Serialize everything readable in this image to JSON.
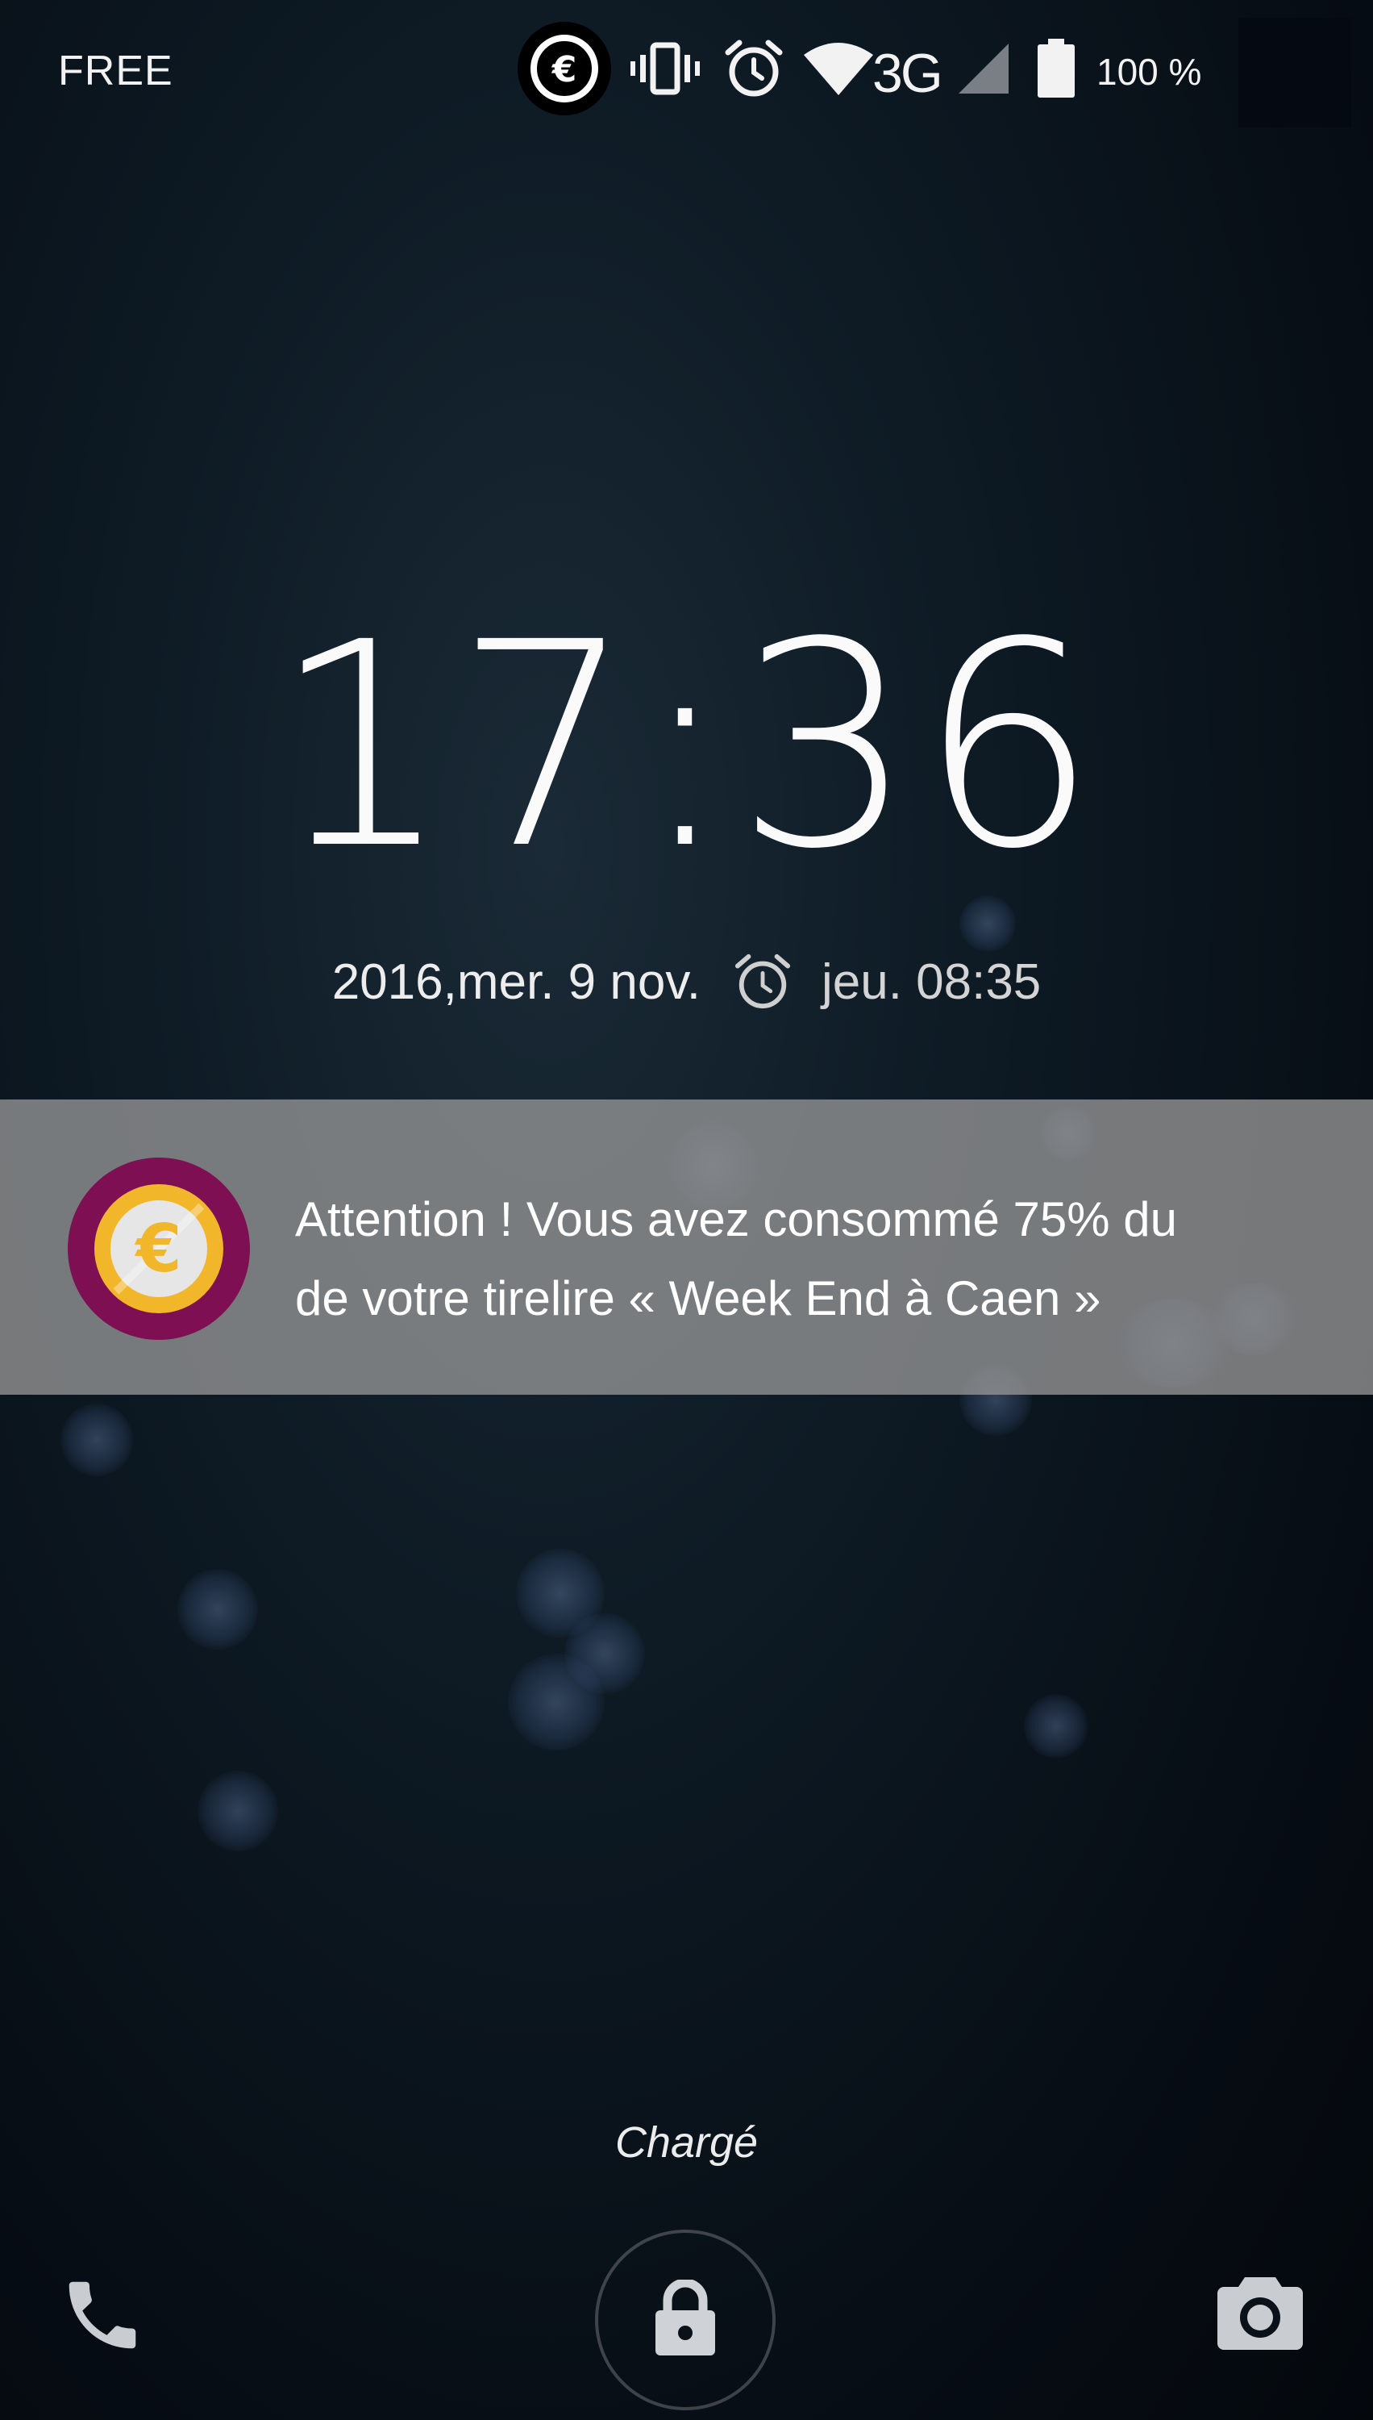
{
  "status_bar": {
    "carrier": "FREE",
    "network_type": "3G",
    "battery_percent": "100 %",
    "battery_level": 1.0,
    "icons": [
      "euro-app-icon",
      "vibrate-icon",
      "alarm-icon",
      "wifi-icon",
      "cellular-signal-icon",
      "battery-icon"
    ]
  },
  "lock_screen": {
    "time": "17:36",
    "date": "2016,mer. 9 nov.",
    "next_alarm": "jeu. 08:35",
    "charge_status": "Chargé",
    "shortcuts": [
      "phone-icon",
      "lock-icon",
      "camera-icon"
    ]
  },
  "notification": {
    "message": "Attention ! Vous avez consommé 75% du de votre tirelire « Week End à Caen »",
    "line1": "Attention ! Vous avez consommé 75% du",
    "line2": "de votre tirelire « Week End à Caen »",
    "icon": "euro-coin-icon",
    "colors": {
      "icon_ring": "#7e0f52",
      "coin_gold": "#f2b62b",
      "coin_center": "#e6e6e6"
    }
  }
}
